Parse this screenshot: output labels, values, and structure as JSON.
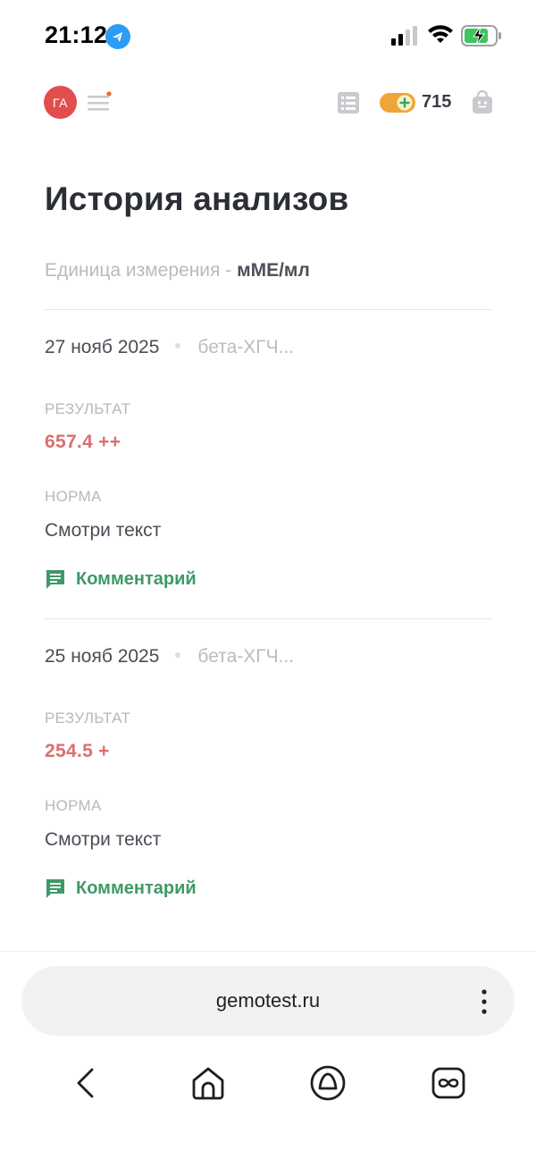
{
  "status_bar": {
    "time": "21:12"
  },
  "header": {
    "avatar_initials": "ГА",
    "bonus_count": "715"
  },
  "page": {
    "title": "История анализов",
    "unit_label": "Единица измерения - ",
    "unit_value": "мМЕ/мл"
  },
  "entries": [
    {
      "date": "27 нояб 2025",
      "test_name": "бета-ХГЧ...",
      "result_label": "РЕЗУЛЬТАТ",
      "result_value": "657.4 ++",
      "norm_label": "НОРМА",
      "norm_value": "Смотри текст",
      "comment_label": "Комментарий"
    },
    {
      "date": "25 нояб 2025",
      "test_name": "бета-ХГЧ...",
      "result_label": "РЕЗУЛЬТАТ",
      "result_value": "254.5 +",
      "norm_label": "НОРМА",
      "norm_value": "Смотри текст",
      "comment_label": "Комментарий"
    }
  ],
  "browser": {
    "url": "gemotest.ru"
  },
  "colors": {
    "avatar": "#e34d4d",
    "result": "#d9706e",
    "comment": "#3e9a67",
    "bonus": "#f0a53a"
  },
  "icons": [
    "telegram-icon",
    "signal-icon",
    "wifi-icon",
    "battery-charging-icon",
    "menu-icon",
    "list-icon",
    "bonus-toggle-icon",
    "shopping-bag-icon",
    "comment-icon",
    "more-icon",
    "back-icon",
    "home-icon",
    "alice-icon",
    "tabs-icon"
  ]
}
